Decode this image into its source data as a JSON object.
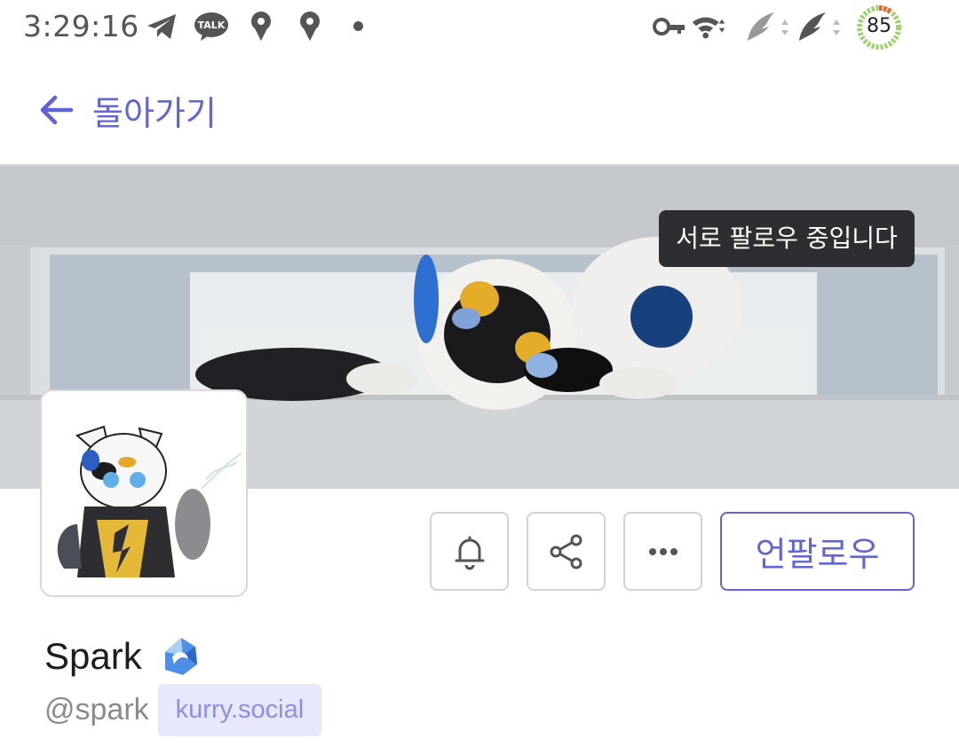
{
  "status_bar": {
    "time": "3:29:16",
    "talk_label": "TALK",
    "battery": "85",
    "icons": [
      "telegram-icon",
      "kakaotalk-icon",
      "location-pin-icon",
      "location-pin-icon",
      "dot-icon",
      "vpn-key-icon",
      "wifi-icon",
      "signal-icon",
      "signal-icon",
      "battery-icon"
    ]
  },
  "header": {
    "back_label": "돌아가기"
  },
  "banner": {
    "tooltip": "서로 팔로우 중입니다"
  },
  "actions": {
    "unfollow_label": "언팔로우",
    "icons": [
      "bell-icon",
      "share-icon",
      "more-icon"
    ]
  },
  "profile": {
    "display_name": "Spark",
    "handle": "@spark",
    "instance": "kurry.social"
  },
  "colors": {
    "accent": "#6366d1",
    "instance_bg": "#e8e8fb",
    "tooltip_bg": "#2c2e31"
  }
}
